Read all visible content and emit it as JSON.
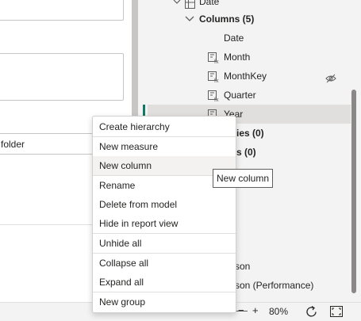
{
  "left": {
    "folder_value": "folder"
  },
  "tree": {
    "table_name": "Date",
    "columns_group": "Columns (5)",
    "columns": [
      {
        "label": "Date"
      },
      {
        "label": "Month"
      },
      {
        "label": "MonthKey"
      },
      {
        "label": "Quarter"
      },
      {
        "label": "Year"
      }
    ],
    "hierarchies_partial": "ies (0)",
    "measures_partial": "s (0)",
    "bottom_items": [
      "son",
      "son (Performance)"
    ]
  },
  "status": {
    "zoom": "80%",
    "minus": "−",
    "plus": "+"
  },
  "menu": {
    "items": [
      "Create hierarchy",
      "New measure",
      "New column",
      "Rename",
      "Delete from model",
      "Hide in report view",
      "Unhide all",
      "Collapse all",
      "Expand all",
      "New group"
    ]
  },
  "tooltip": {
    "text": "New column"
  },
  "colors": {
    "accent": "#117865",
    "selected": "#e1dfdd",
    "border": "#c8c6c4"
  }
}
